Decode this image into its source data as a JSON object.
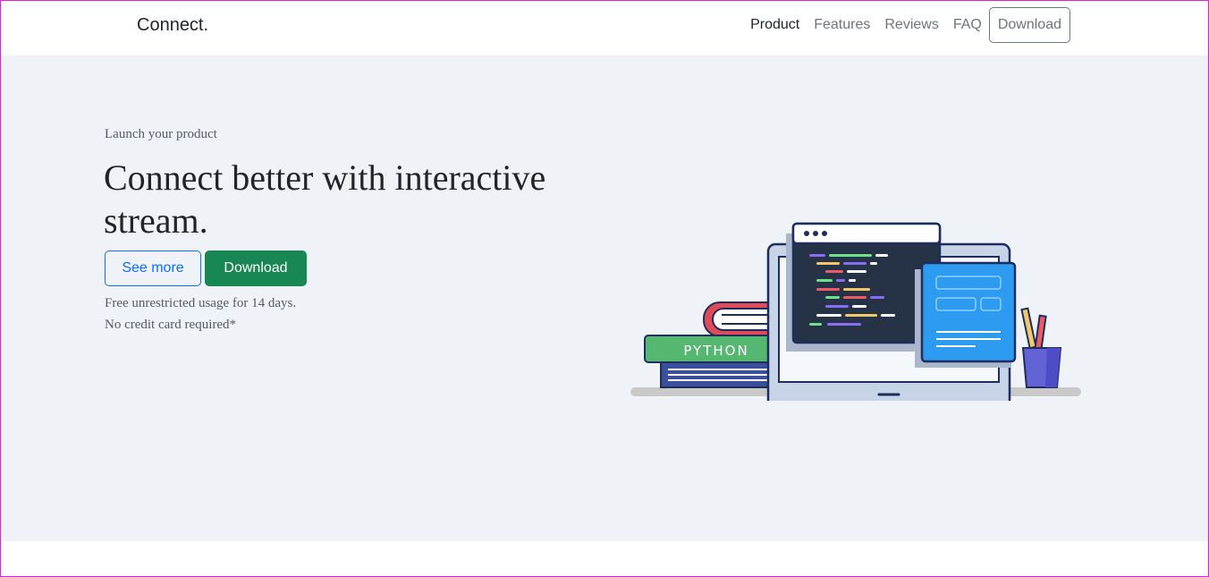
{
  "nav": {
    "brand": "Connect.",
    "links": [
      {
        "label": "Product",
        "active": true
      },
      {
        "label": "Features"
      },
      {
        "label": "Reviews"
      },
      {
        "label": "FAQ"
      }
    ],
    "download_label": "Download"
  },
  "hero": {
    "eyebrow": "Launch your product",
    "headline": "Connect better with interactive stream.",
    "see_more_label": "See more",
    "download_label": "Download",
    "note_line1": "Free unrestricted usage for 14 days.",
    "note_line2": "No credit card required*",
    "illustration": {
      "book_label": "PYTHON",
      "icons": [
        "desktop-monitor-icon",
        "code-window-icon",
        "form-window-icon",
        "books-icon",
        "pencil-cup-icon"
      ]
    }
  },
  "colors": {
    "hero_background": "#eff3f7",
    "primary_outline": "#0d6efd",
    "success": "#198754",
    "text_dark": "#212529",
    "text_muted": "#6c757d"
  }
}
